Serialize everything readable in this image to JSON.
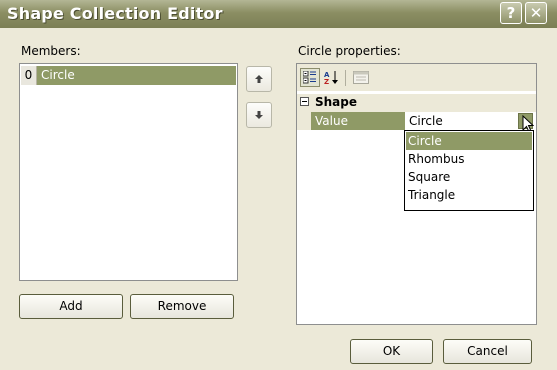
{
  "window": {
    "title": "Shape Collection Editor",
    "help_glyph": "?",
    "close_glyph": "✕"
  },
  "members": {
    "label": "Members:",
    "items": [
      {
        "index": "0",
        "name": "Circle"
      }
    ]
  },
  "properties": {
    "label": "Circle properties:",
    "category": "Shape",
    "property_name": "Value",
    "property_value": "Circle",
    "dropdown_options": [
      "Circle",
      "Rhombus",
      "Square",
      "Triangle"
    ],
    "selected_option": "Circle"
  },
  "buttons": {
    "add": "Add",
    "remove": "Remove",
    "ok": "OK",
    "cancel": "Cancel"
  },
  "icons": {
    "move_up": "arrow-up-icon",
    "move_down": "arrow-down-icon",
    "categorized": "categorized-icon",
    "alphabetical": "alphabetical-sort-icon",
    "property_pages": "property-pages-icon"
  },
  "colors": {
    "selection": "#8f9a66",
    "titlebar": "#8b8e63",
    "window_bg": "#ece9d8"
  }
}
